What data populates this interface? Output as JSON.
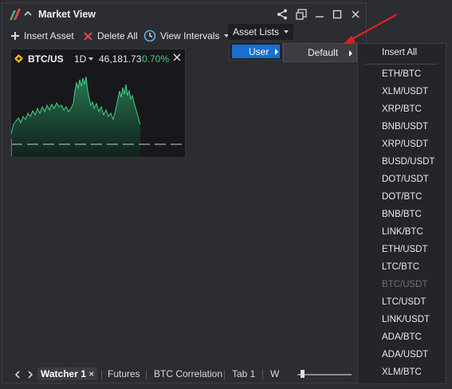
{
  "window": {
    "title": "Market View"
  },
  "toolbar": {
    "insert_asset": "Insert Asset",
    "delete_all": "Delete All",
    "view_intervals": "View Intervals",
    "asset_lists": "Asset Lists"
  },
  "chart_card": {
    "symbol": "BTC/US",
    "interval": "1D",
    "price": "46,181.73",
    "change": "0.70%",
    "colors": {
      "change": "#3fd17f",
      "area": "#1e6a4a",
      "line": "#3fd17f"
    }
  },
  "menus": {
    "user_label": "User",
    "default_label": "Default",
    "insert_all": "Insert All",
    "assets": [
      {
        "label": "ETH/BTC",
        "disabled": false
      },
      {
        "label": "XLM/USDT",
        "disabled": false
      },
      {
        "label": "XRP/BTC",
        "disabled": false
      },
      {
        "label": "BNB/USDT",
        "disabled": false
      },
      {
        "label": "XRP/USDT",
        "disabled": false
      },
      {
        "label": "BUSD/USDT",
        "disabled": false
      },
      {
        "label": "DOT/USDT",
        "disabled": false
      },
      {
        "label": "DOT/BTC",
        "disabled": false
      },
      {
        "label": "BNB/BTC",
        "disabled": false
      },
      {
        "label": "LINK/BTC",
        "disabled": false
      },
      {
        "label": "ETH/USDT",
        "disabled": false
      },
      {
        "label": "LTC/BTC",
        "disabled": false
      },
      {
        "label": "BTC/USDT",
        "disabled": true
      },
      {
        "label": "LTC/USDT",
        "disabled": false
      },
      {
        "label": "LINK/USDT",
        "disabled": false
      },
      {
        "label": "ADA/BTC",
        "disabled": false
      },
      {
        "label": "ADA/USDT",
        "disabled": false
      },
      {
        "label": "XLM/BTC",
        "disabled": false
      }
    ]
  },
  "tabs": {
    "watcher1": "Watcher 1",
    "futures": "Futures",
    "btc_correlation": "BTC Correlation",
    "tab1": "Tab 1",
    "w": "W"
  },
  "accent_colors": {
    "highlight": "#1a6fd1",
    "annotation_arrow": "#e02020"
  }
}
